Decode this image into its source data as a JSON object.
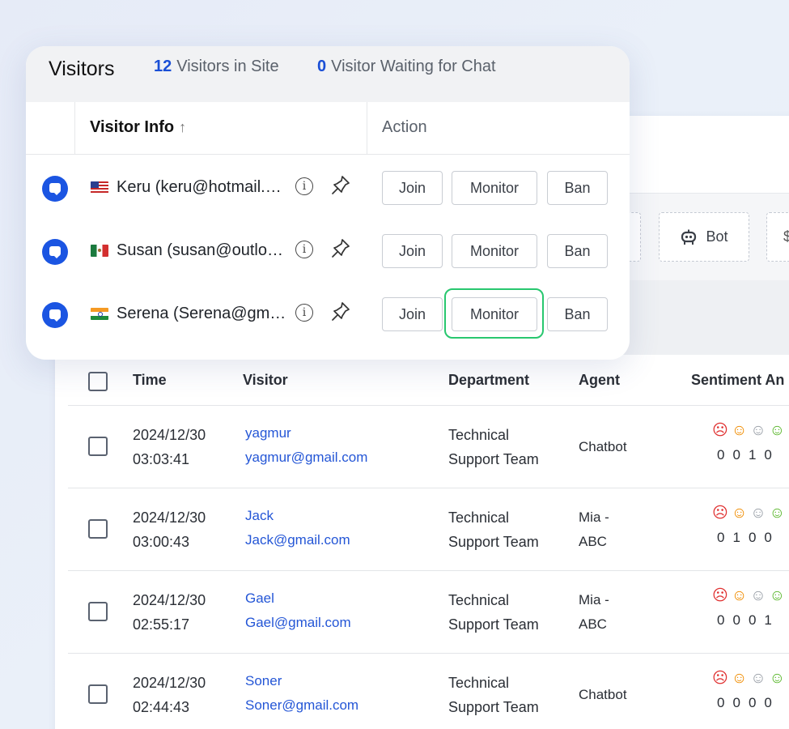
{
  "popup": {
    "title": "Visitors",
    "stats": [
      {
        "count": "12",
        "label": "Visitors in Site"
      },
      {
        "count": "0",
        "label": "Visitor Waiting for Chat"
      }
    ],
    "col_visitor_info": "Visitor Info",
    "sort_arrow": "↑",
    "col_action": "Action",
    "visitors": [
      {
        "flag": "flag-us",
        "name": "Keru (keru@hotmail.com)",
        "join": "Join",
        "monitor": "Monitor",
        "ban": "Ban"
      },
      {
        "flag": "flag-mx",
        "name": "Susan (susan@outlook.com)",
        "join": "Join",
        "monitor": "Monitor",
        "ban": "Ban"
      },
      {
        "flag": "flag-in",
        "name": "Serena (Serena@gmail.com)",
        "join": "Join",
        "monitor": "Monitor",
        "ban": "Ban",
        "highlighted": true
      }
    ]
  },
  "filters": {
    "bot_label": "Bot",
    "next_partial": "$"
  },
  "table": {
    "headers": [
      "Time",
      "Visitor",
      "Department",
      "Agent",
      "Sentiment An"
    ],
    "rows": [
      {
        "date": "2024/12/30",
        "time": "03:03:41",
        "visitor_name": "yagmur",
        "visitor_email": "yagmur@gmail.com",
        "dept_1": "Technical",
        "dept_2": "Support Team",
        "agent_1": "Chatbot",
        "agent_2": "",
        "counts": [
          "0",
          "0",
          "1",
          "0"
        ]
      },
      {
        "date": "2024/12/30",
        "time": "03:00:43",
        "visitor_name": "Jack",
        "visitor_email": "Jack@gmail.com",
        "dept_1": "Technical",
        "dept_2": "Support Team",
        "agent_1": "Mia -",
        "agent_2": "ABC",
        "counts": [
          "0",
          "1",
          "0",
          "0"
        ]
      },
      {
        "date": "2024/12/30",
        "time": "02:55:17",
        "visitor_name": "Gael",
        "visitor_email": "Gael@gmail.com",
        "dept_1": "Technical",
        "dept_2": "Support Team",
        "agent_1": "Mia -",
        "agent_2": "ABC",
        "counts": [
          "0",
          "0",
          "0",
          "1"
        ]
      },
      {
        "date": "2024/12/30",
        "time": "02:44:43",
        "visitor_name": "Soner",
        "visitor_email": "Soner@gmail.com",
        "dept_1": "Technical",
        "dept_2": "Support Team",
        "agent_1": "Chatbot",
        "agent_2": "",
        "counts": [
          "0",
          "0",
          "0",
          "0"
        ]
      }
    ]
  },
  "colors": {
    "accent": "#1b55e2",
    "link": "#2456d6",
    "highlight": "#28c76f",
    "sentiment_negative": "#e03131",
    "sentiment_mixed": "#f08c00",
    "sentiment_neutral": "#9aa0a8",
    "sentiment_positive": "#5cb82e"
  }
}
